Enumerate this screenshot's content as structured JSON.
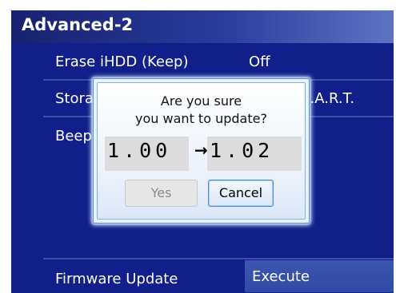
{
  "screen": {
    "title": "Advanced-2",
    "rows": [
      {
        "label": "Erase iHDD (Keep)",
        "value": "Off"
      },
      {
        "label": "Stora",
        "value": "M.A.R.T."
      },
      {
        "label": "Beep",
        "value": ""
      }
    ],
    "firmware": {
      "label": "Firmware Update",
      "value": "Execute"
    }
  },
  "dialog": {
    "line1": "Are you sure",
    "line2": "you want to update?",
    "current_version": "1.00",
    "arrow": "→",
    "new_version": "1.02",
    "yes_label": "Yes",
    "cancel_label": "Cancel"
  },
  "colors": {
    "screen_bg": "#101f8a",
    "title_gradient_end": "#5d74c2",
    "highlight": "#2f4aa4"
  }
}
